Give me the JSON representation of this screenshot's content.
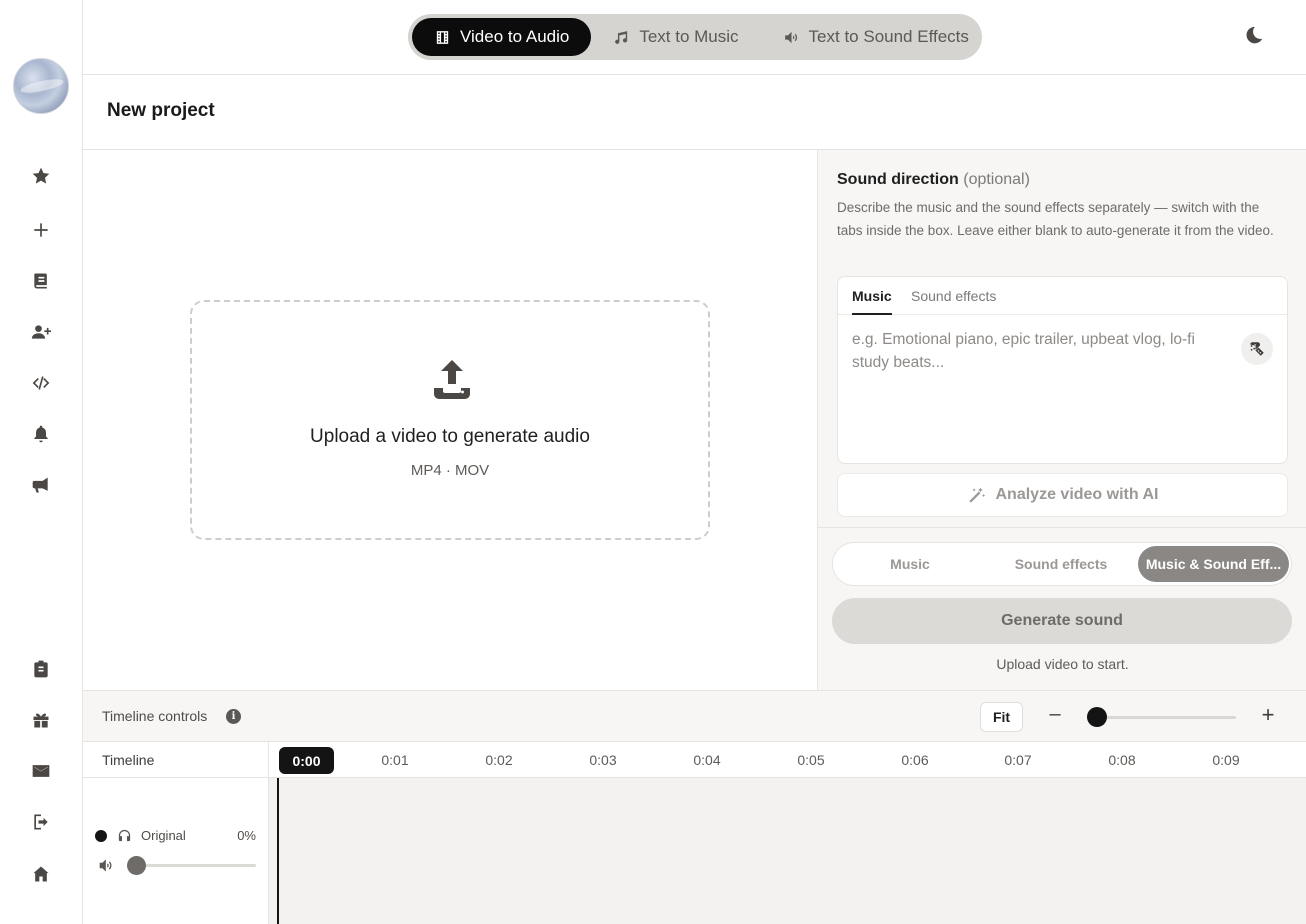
{
  "top_modes": [
    {
      "label": "Video to Audio",
      "icon": "film-icon",
      "active": true
    },
    {
      "label": "Text to Music",
      "icon": "music-note-icon",
      "active": false
    },
    {
      "label": "Text to Sound Effects",
      "icon": "speaker-icon",
      "active": false
    }
  ],
  "project": {
    "title": "New project"
  },
  "upload": {
    "title": "Upload a video to generate audio",
    "formats": "MP4 · MOV"
  },
  "sound_direction": {
    "title": "Sound direction",
    "optional": "(optional)",
    "description": "Describe the music and the sound effects separately — switch with the tabs inside the box. Leave either blank to auto-generate it from the video.",
    "tabs": [
      "Music",
      "Sound effects"
    ],
    "placeholder": "e.g. Emotional piano, epic trailer, upbeat vlog, lo-fi study beats..."
  },
  "analyze": {
    "label": "Analyze video with AI"
  },
  "output_mode": {
    "options": [
      "Music",
      "Sound effects",
      "Music & Sound Eff..."
    ],
    "selected": 2
  },
  "generate": {
    "label": "Generate sound",
    "hint": "Upload video to start."
  },
  "timeline_controls": {
    "label": "Timeline controls",
    "fit_label": "Fit",
    "minus": "–",
    "plus": "+"
  },
  "timeline": {
    "title": "Timeline",
    "playhead": "0:00",
    "ticks": [
      "0:01",
      "0:02",
      "0:03",
      "0:04",
      "0:05",
      "0:06",
      "0:07",
      "0:08",
      "0:09"
    ],
    "track": {
      "name": "Original",
      "volume": "0%"
    }
  },
  "colors": {
    "accent": "#0c0c0c",
    "panel": "#f7f6f4",
    "muted": "#8a8784"
  }
}
